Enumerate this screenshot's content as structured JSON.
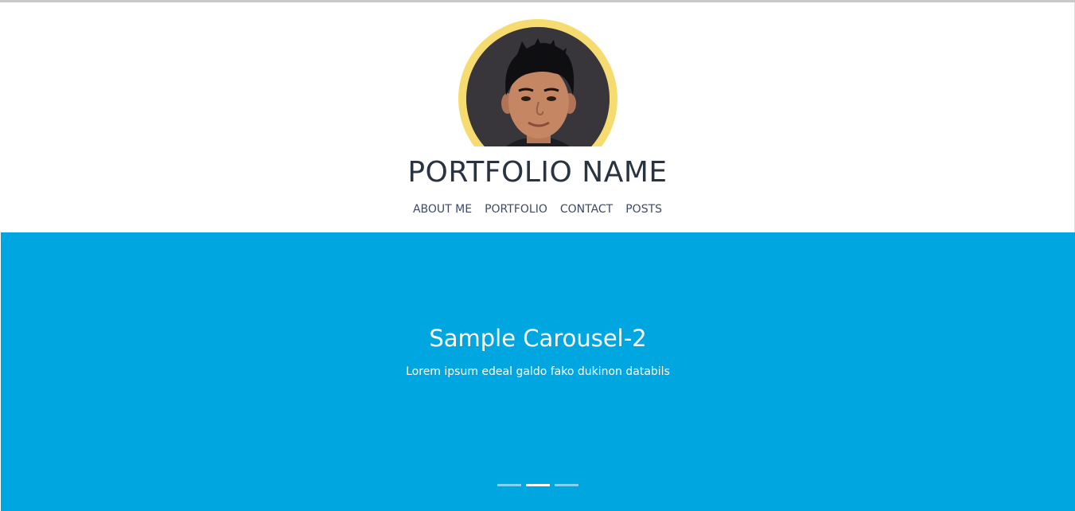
{
  "header": {
    "title": "PORTFOLIO NAME",
    "avatar_ring_color": "#f6dc70"
  },
  "nav": {
    "items": [
      {
        "label": "ABOUT ME"
      },
      {
        "label": "PORTFOLIO"
      },
      {
        "label": "CONTACT"
      },
      {
        "label": "POSTS"
      }
    ]
  },
  "carousel": {
    "background_color": "#00a6e0",
    "slide": {
      "title": "Sample Carousel-2",
      "caption": "Lorem ipsum edeal galdo fako dukinon databils"
    },
    "indicator_count": 3,
    "active_index": 1
  }
}
